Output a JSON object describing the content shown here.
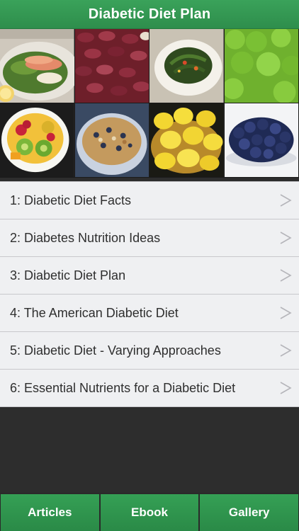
{
  "header": {
    "title": "Diabetic Diet Plan"
  },
  "gallery": {
    "tiles": [
      {
        "name": "salad-photo"
      },
      {
        "name": "kidney-beans-photo"
      },
      {
        "name": "greens-bowl-photo"
      },
      {
        "name": "lettuce-photo"
      },
      {
        "name": "fruit-salad-photo"
      },
      {
        "name": "granola-bowl-photo"
      },
      {
        "name": "lemons-photo"
      },
      {
        "name": "blueberries-photo"
      }
    ]
  },
  "list": {
    "items": [
      {
        "label": "1: Diabetic Diet Facts"
      },
      {
        "label": "2: Diabetes Nutrition Ideas"
      },
      {
        "label": "3: Diabetic Diet Plan"
      },
      {
        "label": "4: The American Diabetic Diet"
      },
      {
        "label": "5: Diabetic Diet - Varying Approaches"
      },
      {
        "label": "6: Essential Nutrients for a Diabetic Diet"
      }
    ],
    "chevron_icon": "chevron-right-icon"
  },
  "tabbar": {
    "tabs": [
      {
        "label": "Articles"
      },
      {
        "label": "Ebook"
      },
      {
        "label": "Gallery"
      }
    ]
  },
  "colors": {
    "header_green": "#3aa25a",
    "list_background": "#eff0f2",
    "app_background": "#2d2d2d"
  }
}
